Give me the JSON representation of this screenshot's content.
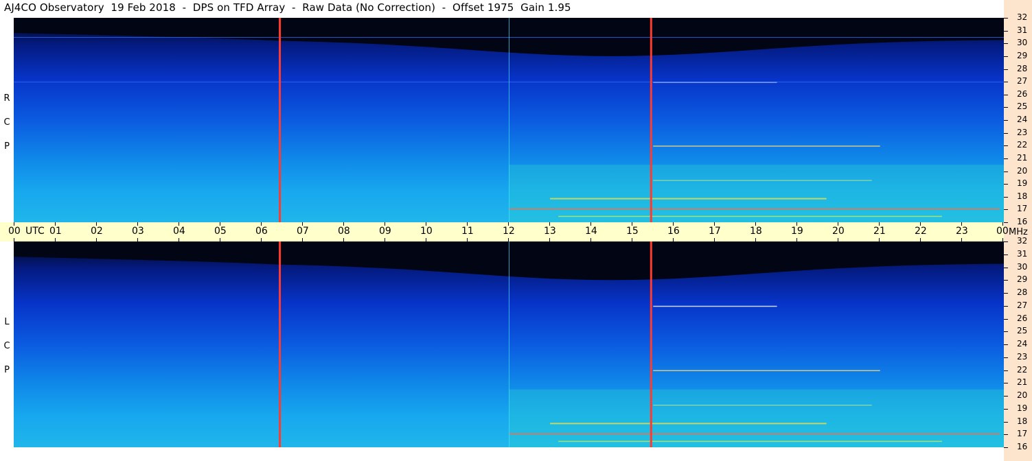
{
  "window_title": "AJ4CO Observatory  19 Feb 2018  -  DPS on TFD Array  -  Raw Data (No Correction)  -  Offset 1975  Gain 1.95",
  "colors": {
    "background_night": "#02071c",
    "low_band": "#1aa3ee",
    "high_band": "#0a2fc4",
    "side_strip": "#fde4cd",
    "time_axis": "#ffffcc",
    "vertical_markers": "#ff3b2f"
  },
  "chart_data": [
    {
      "type": "heatmap",
      "panel": "top",
      "ylabel": "R C P",
      "y_unit": "MHz",
      "ylim": [
        16,
        32
      ],
      "xlim": [
        0,
        24
      ],
      "x_ticks": [
        "00 UTC",
        "01",
        "02",
        "03",
        "04",
        "05",
        "06",
        "07",
        "08",
        "09",
        "10",
        "11",
        "12",
        "13",
        "14",
        "15",
        "16",
        "17",
        "18",
        "19",
        "20",
        "21",
        "22",
        "23",
        "00 MHz"
      ],
      "y_ticks": [
        "32",
        "31",
        "30",
        "29",
        "28",
        "27",
        "26",
        "25",
        "24",
        "23",
        "22",
        "21",
        "20",
        "19",
        "18",
        "17",
        "16"
      ],
      "vertical_markers_utc": [
        6.45,
        15.45
      ],
      "cyan_marker_utc": [
        12.0
      ],
      "horizontal_line_mhz": [
        27.0,
        30.5
      ]
    },
    {
      "type": "heatmap",
      "panel": "bottom",
      "ylabel": "L C P",
      "y_unit": "MHz",
      "ylim": [
        16,
        32
      ],
      "xlim": [
        0,
        24
      ],
      "x_ticks": [
        "00 UTC",
        "01",
        "02",
        "03",
        "04",
        "05",
        "06",
        "07",
        "08",
        "09",
        "10",
        "11",
        "12",
        "13",
        "14",
        "15",
        "16",
        "17",
        "18",
        "19",
        "20",
        "21",
        "22",
        "23",
        "00 MHz"
      ],
      "y_ticks": [
        "32",
        "31",
        "30",
        "29",
        "28",
        "27",
        "26",
        "25",
        "24",
        "23",
        "22",
        "21",
        "20",
        "19",
        "18",
        "17",
        "16"
      ],
      "vertical_markers_utc": [
        6.45,
        15.45
      ],
      "cyan_marker_utc": [
        12.0
      ],
      "horizontal_line_mhz": []
    }
  ],
  "time_axis": {
    "labels": [
      "00",
      "UTC",
      "01",
      "02",
      "03",
      "04",
      "05",
      "06",
      "07",
      "08",
      "09",
      "10",
      "11",
      "12",
      "13",
      "14",
      "15",
      "16",
      "17",
      "18",
      "19",
      "20",
      "21",
      "22",
      "23",
      "00",
      "MHz"
    ]
  },
  "freq_labels": [
    "32",
    "31",
    "30",
    "29",
    "28",
    "27",
    "26",
    "25",
    "24",
    "23",
    "22",
    "21",
    "20",
    "19",
    "18",
    "17",
    "16"
  ],
  "polarization": {
    "top": "R C P",
    "bottom": "L C P"
  }
}
